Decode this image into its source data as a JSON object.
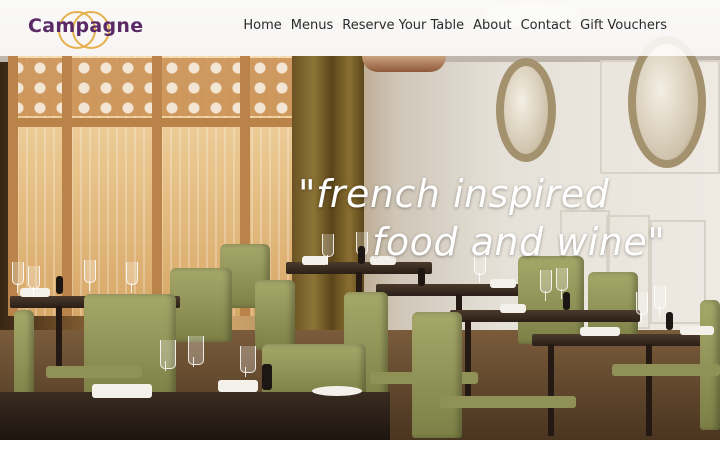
{
  "brand": {
    "name": "Campagne"
  },
  "nav": {
    "items": [
      {
        "label": "Home"
      },
      {
        "label": "Menus"
      },
      {
        "label": "Reserve Your Table"
      },
      {
        "label": "About"
      },
      {
        "label": "Contact"
      },
      {
        "label": "Gift Vouchers"
      }
    ]
  },
  "hero": {
    "tagline_line1": "\"french inspired",
    "tagline_line2": "food and wine\""
  },
  "colors": {
    "brand_purple": "#5b2a66",
    "brand_gold": "#e6b04a",
    "nav_text": "#2b2b2b",
    "tagline_text": "#ffffff"
  }
}
